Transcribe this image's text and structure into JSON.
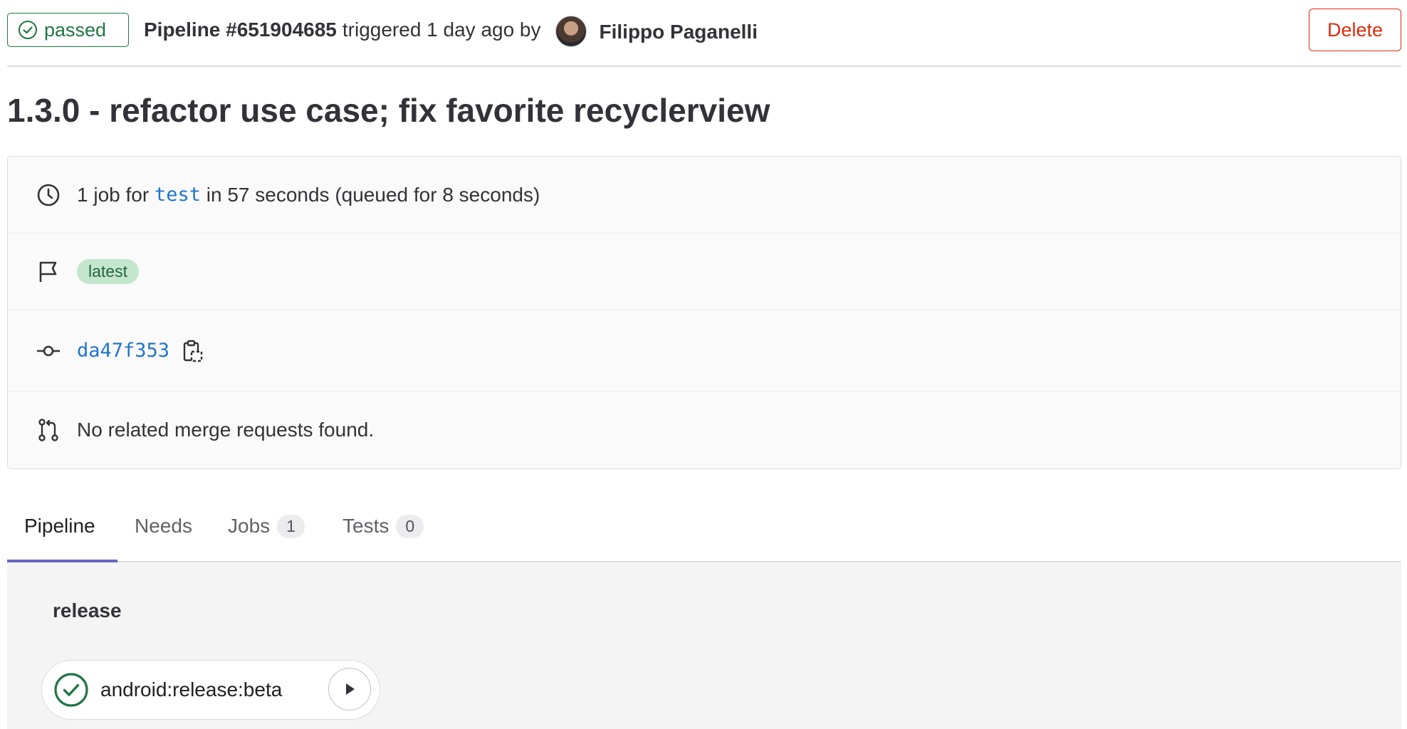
{
  "header": {
    "status": "passed",
    "pipeline_id": "Pipeline #651904685",
    "triggered_text": "triggered 1 day ago by",
    "author": "Filippo Paganelli",
    "delete_label": "Delete"
  },
  "commit_title": "1.3.0 - refactor use case; fix favorite recyclerview",
  "info": {
    "jobs_prefix": "1 job for",
    "ref": "test",
    "jobs_suffix": "in 57 seconds (queued for 8 seconds)",
    "tag": "latest",
    "commit_sha": "da47f353",
    "merge_requests": "No related merge requests found."
  },
  "tabs": [
    {
      "label": "Pipeline",
      "active": true
    },
    {
      "label": "Needs"
    },
    {
      "label": "Jobs",
      "count": "1"
    },
    {
      "label": "Tests",
      "count": "0"
    }
  ],
  "pipeline": {
    "stage": "release",
    "job": "android:release:beta",
    "job_status": "success"
  },
  "colors": {
    "success": "#217645",
    "danger": "#dd2b0e",
    "link": "#1f75cb",
    "tab_active": "#6666c4"
  },
  "icons": [
    "status-passed-icon",
    "clock-icon",
    "flag-icon",
    "commit-icon",
    "copy-icon",
    "merge-request-icon",
    "play-icon"
  ]
}
